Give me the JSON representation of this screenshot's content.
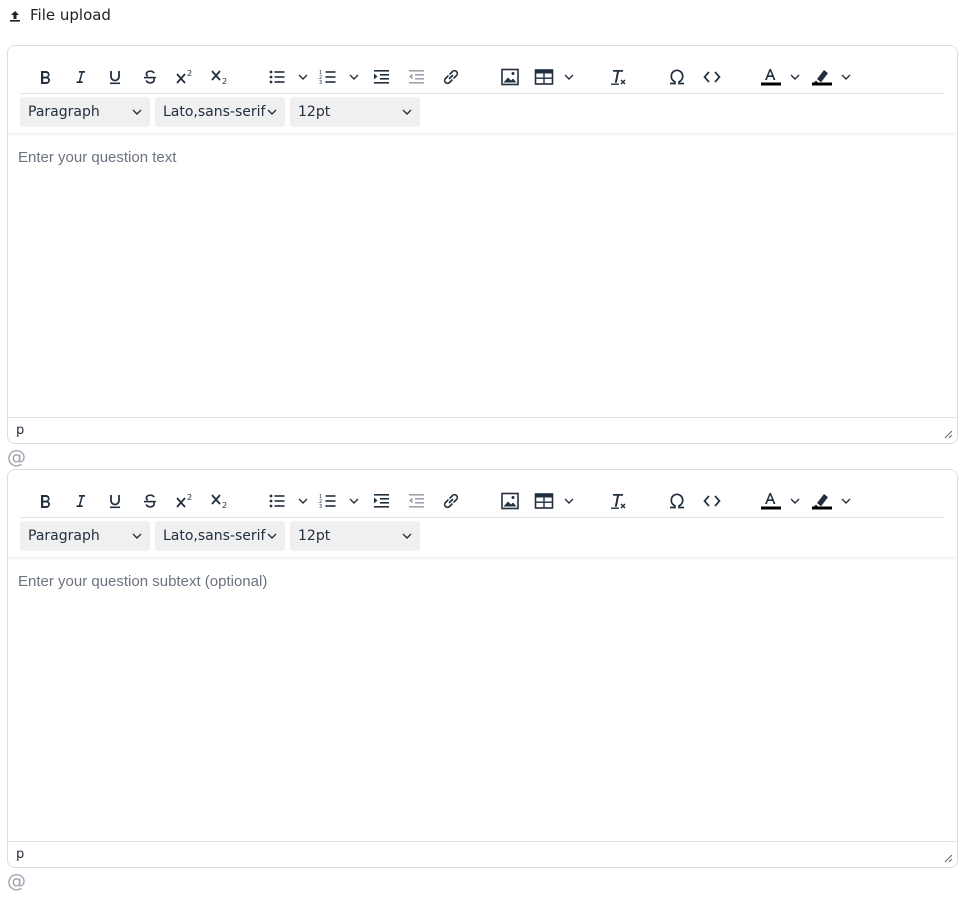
{
  "header": {
    "title": "File upload",
    "icon": "upload-icon"
  },
  "editors": [
    {
      "placeholder": "Enter your question text",
      "status_path": "p",
      "block_format": "Paragraph",
      "font_family": "Lato,sans-serif",
      "font_size": "12pt"
    },
    {
      "placeholder": "Enter your question subtext (optional)",
      "status_path": "p",
      "block_format": "Paragraph",
      "font_family": "Lato,sans-serif",
      "font_size": "12pt"
    }
  ],
  "mention_symbol": "@",
  "colors": {
    "icon": "#222f3e",
    "placeholder": "#6b7280",
    "border": "#dcdde1",
    "disabled_icon": "#9ca3af"
  }
}
